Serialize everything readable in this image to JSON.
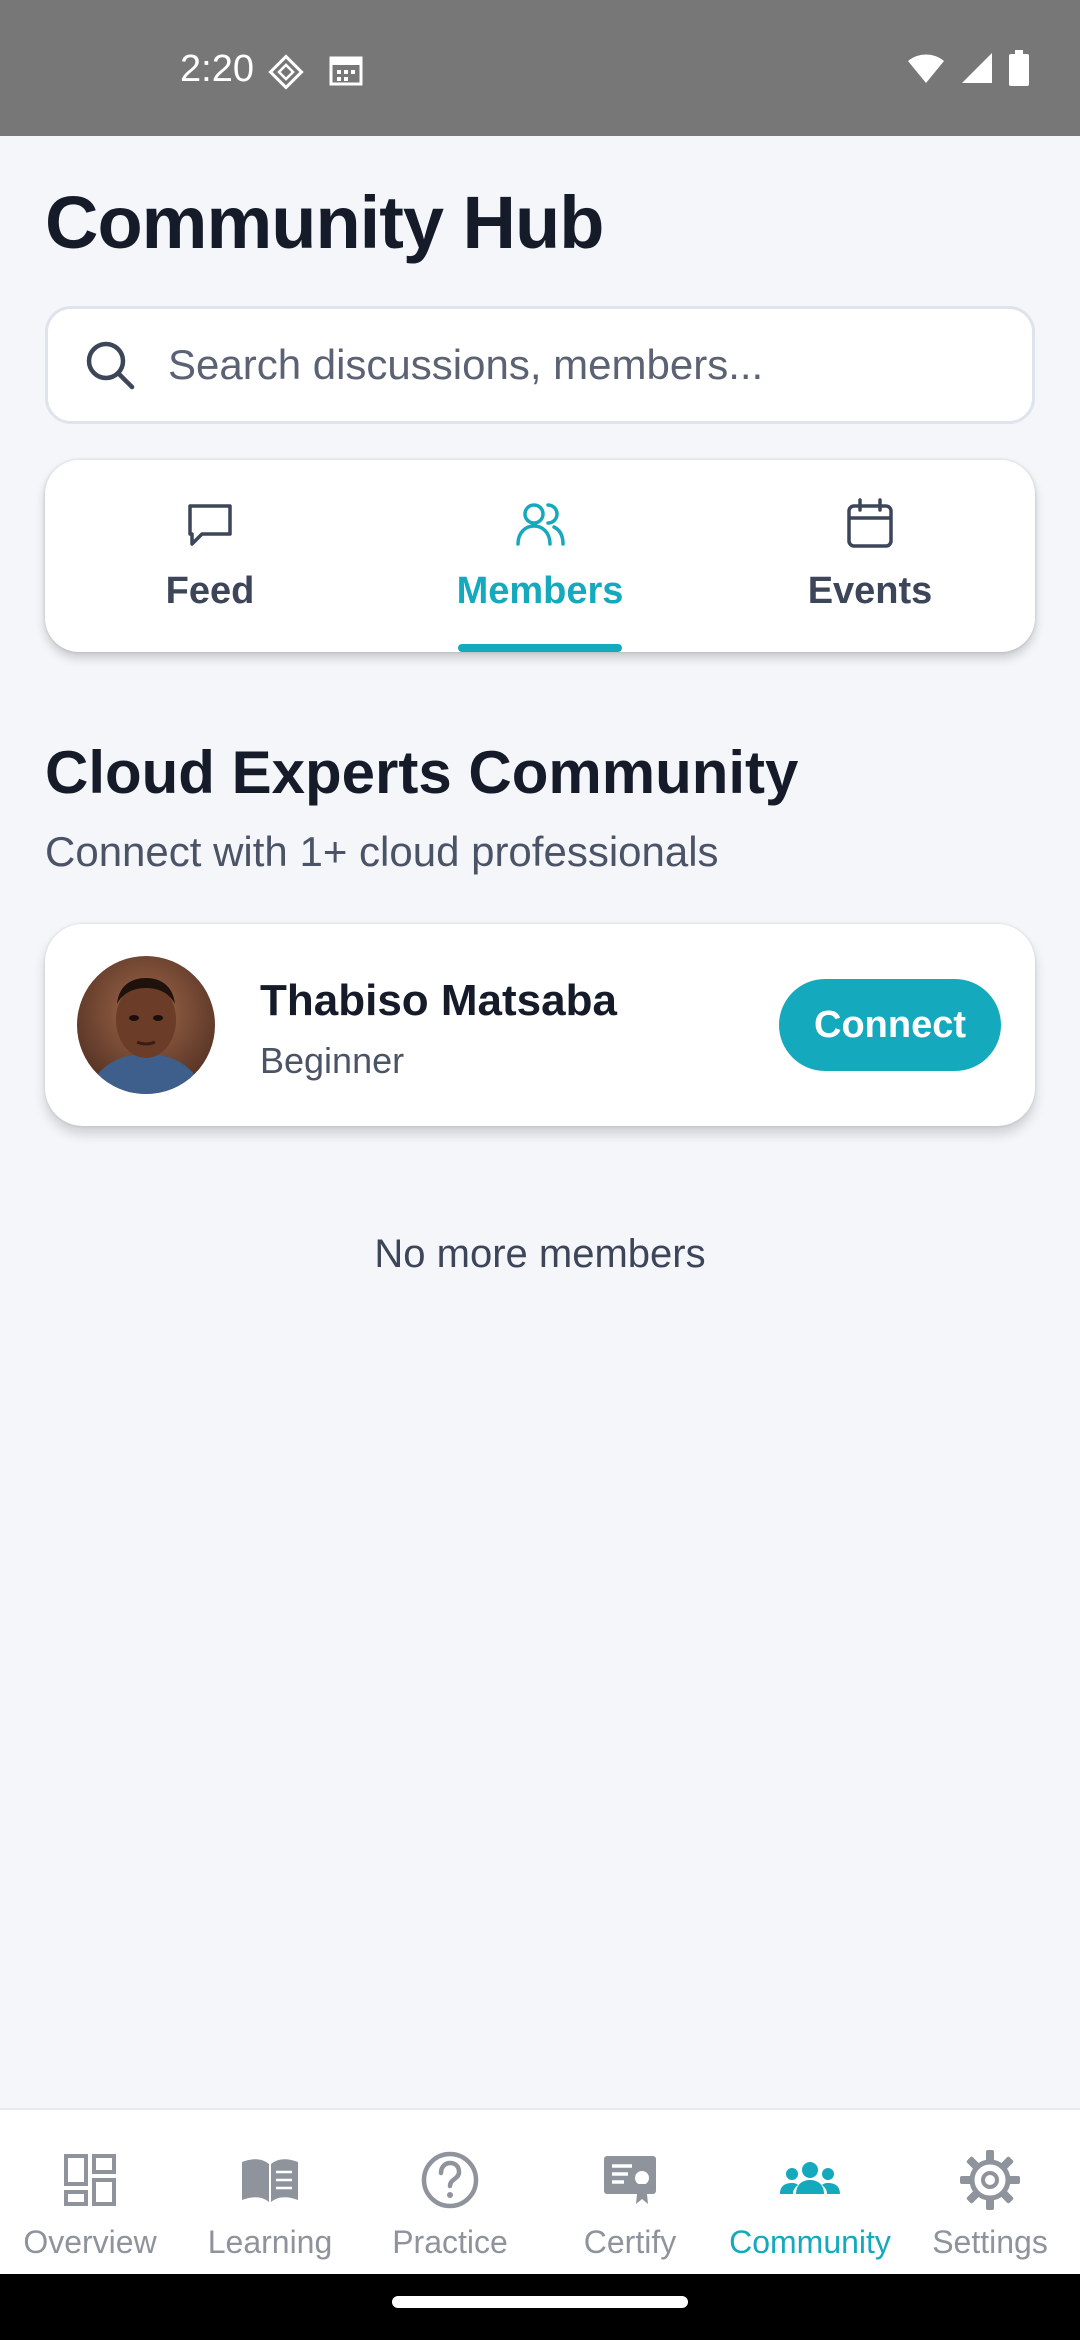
{
  "status_bar": {
    "time": "2:20"
  },
  "header": {
    "title": "Community Hub"
  },
  "search": {
    "placeholder": "Search discussions, members..."
  },
  "tabs": [
    {
      "label": "Feed",
      "icon": "chat-bubble-icon",
      "active": false
    },
    {
      "label": "Members",
      "icon": "users-icon",
      "active": true
    },
    {
      "label": "Events",
      "icon": "calendar-icon",
      "active": false
    }
  ],
  "section": {
    "title": "Cloud Experts Community",
    "subtitle": "Connect with 1+ cloud professionals"
  },
  "members": [
    {
      "name": "Thabiso Matsaba",
      "level": "Beginner",
      "action_label": "Connect"
    }
  ],
  "empty_state": {
    "text": "No more members"
  },
  "bottom_nav": [
    {
      "label": "Overview",
      "icon": "dashboard-icon",
      "active": false
    },
    {
      "label": "Learning",
      "icon": "book-icon",
      "active": false
    },
    {
      "label": "Practice",
      "icon": "question-icon",
      "active": false
    },
    {
      "label": "Certify",
      "icon": "certificate-icon",
      "active": false
    },
    {
      "label": "Community",
      "icon": "people-icon",
      "active": true
    },
    {
      "label": "Settings",
      "icon": "gear-icon",
      "active": false
    }
  ],
  "colors": {
    "accent": "#15a9be",
    "background": "#f4f6fa",
    "inactive": "#8e939c"
  }
}
